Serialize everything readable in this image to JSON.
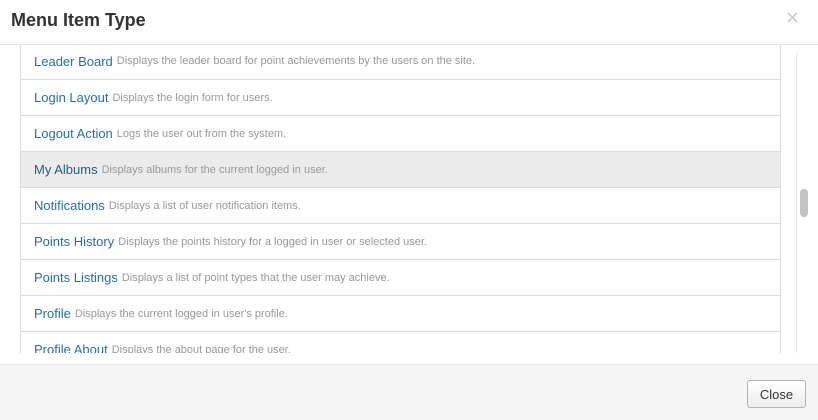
{
  "modal": {
    "title": "Menu Item Type",
    "close_glyph": "×",
    "close_icon": "close-icon",
    "footer_close_label": "Close"
  },
  "list": {
    "items": [
      {
        "title": "Leader Board",
        "description": "Displays the leader board for point achievements by the users on the site.",
        "active": false
      },
      {
        "title": "Login Layout",
        "description": "Displays the login form for users.",
        "active": false
      },
      {
        "title": "Logout Action",
        "description": "Logs the user out from the system.",
        "active": false
      },
      {
        "title": "My Albums",
        "description": "Displays albums for the current logged in user.",
        "active": true
      },
      {
        "title": "Notifications",
        "description": "Displays a list of user notification items.",
        "active": false
      },
      {
        "title": "Points History",
        "description": "Displays the points history for a logged in user or selected user.",
        "active": false
      },
      {
        "title": "Points Listings",
        "description": "Displays a list of point types that the user may achieve.",
        "active": false
      },
      {
        "title": "Profile",
        "description": "Displays the current logged in user's profile.",
        "active": false
      },
      {
        "title": "Profile About",
        "description": "Displays the about page for the user.",
        "active": false
      }
    ]
  },
  "colors": {
    "link": "#2a6ea8",
    "description": "#999999",
    "active_row": "#ebebeb",
    "footer": "#f5f5f5"
  }
}
